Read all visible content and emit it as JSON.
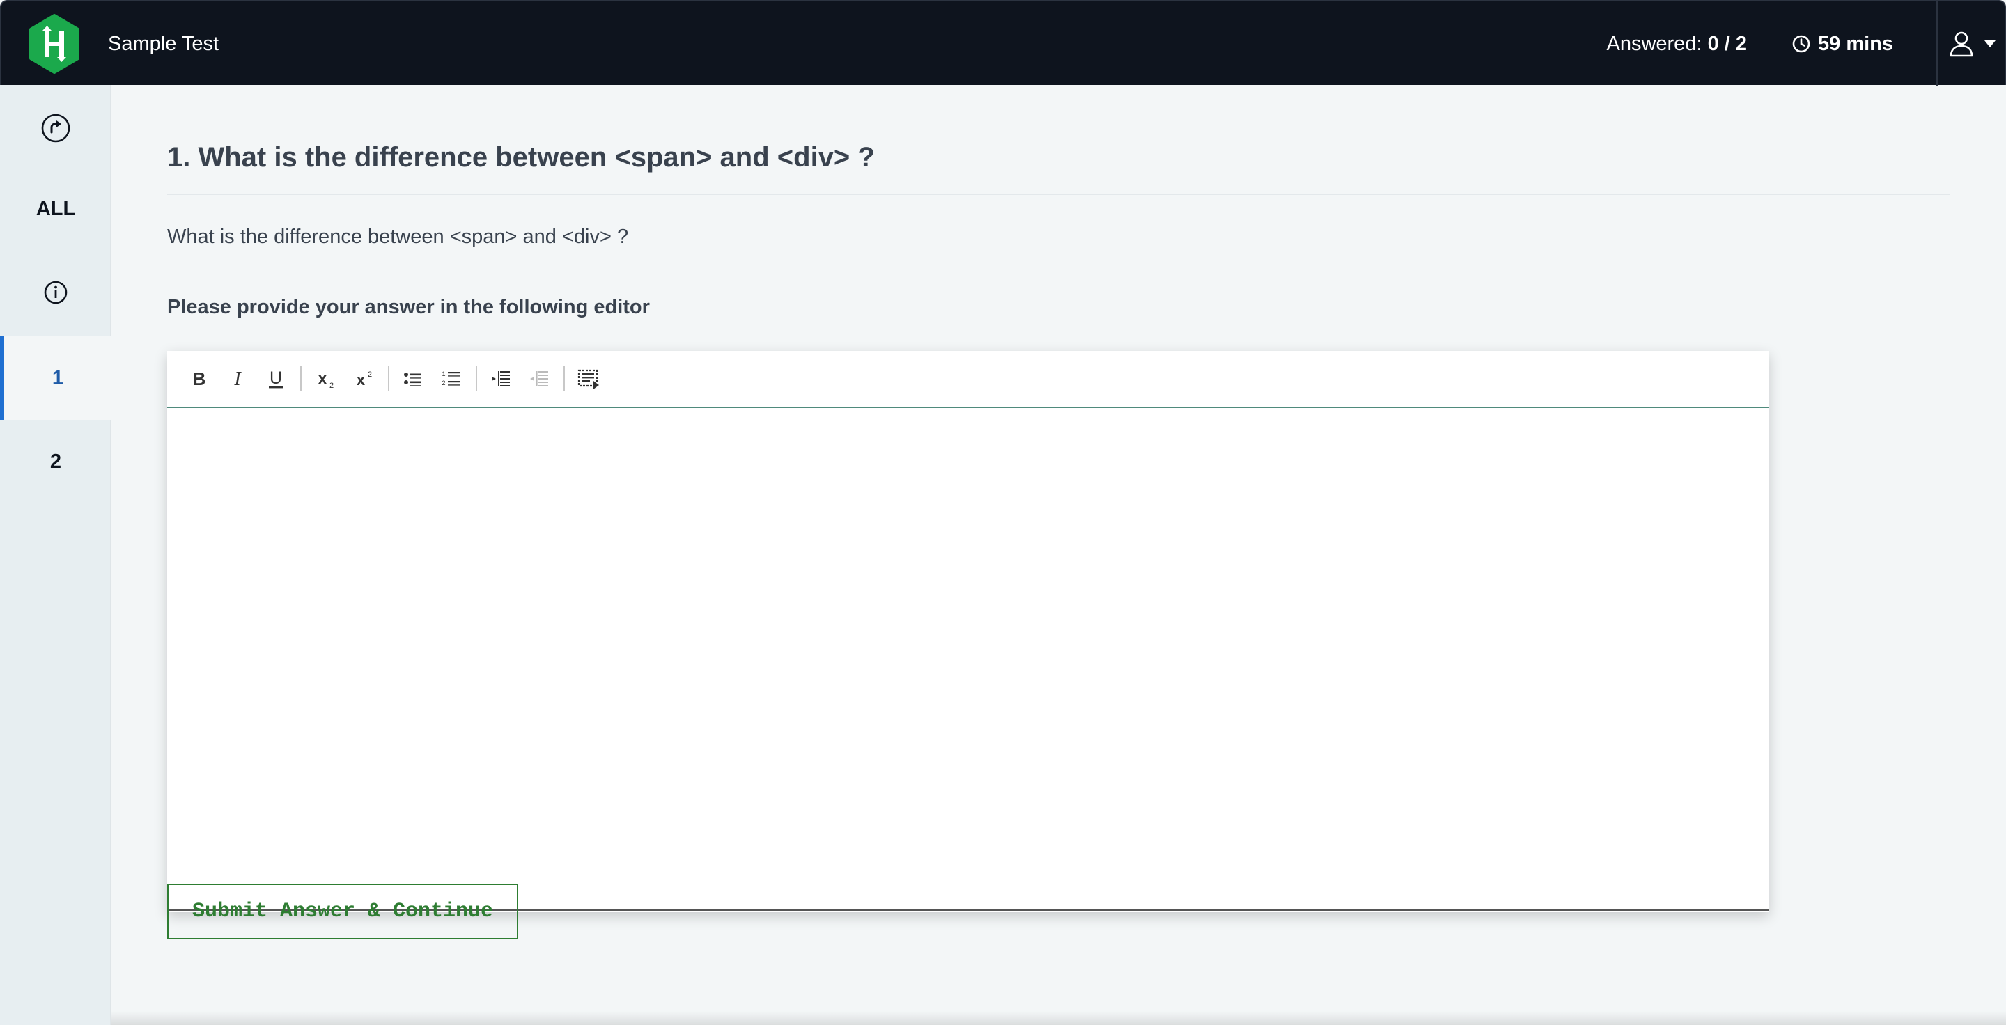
{
  "header": {
    "app_name": "Sample Test",
    "answered_label": "Answered:",
    "answered_value": "0 / 2",
    "timer_value": "59 mins",
    "logo_icon": "hackerrank-logo",
    "timer_icon": "clock-icon",
    "user_icon": "user-icon",
    "colors": {
      "background": "#0e141e",
      "logo": "#1ba94c"
    }
  },
  "sidebar": {
    "items": [
      {
        "type": "icon",
        "icon": "compass-icon"
      },
      {
        "type": "text",
        "label": "ALL"
      },
      {
        "type": "icon",
        "icon": "info-icon"
      },
      {
        "type": "text",
        "label": "1",
        "active": true
      },
      {
        "type": "text",
        "label": "2"
      }
    ],
    "colors": {
      "active": "#1f6fd1",
      "background": "#e7eef1"
    }
  },
  "question": {
    "title": "1. What is the difference between <span> and <div> ?",
    "text": "What is the difference between <span> and <div> ?",
    "instruction": "Please provide your answer in the following editor"
  },
  "editor": {
    "content": "",
    "toolbar": [
      {
        "name": "bold-button",
        "icon": "bold-icon"
      },
      {
        "name": "italic-button",
        "icon": "italic-icon"
      },
      {
        "name": "underline-button",
        "icon": "underline-icon"
      },
      {
        "name": "subscript-button",
        "icon": "subscript-icon"
      },
      {
        "name": "superscript-button",
        "icon": "superscript-icon"
      },
      {
        "name": "bulleted-list-button",
        "icon": "bulleted-list-icon"
      },
      {
        "name": "numbered-list-button",
        "icon": "numbered-list-icon"
      },
      {
        "name": "indent-button",
        "icon": "indent-icon"
      },
      {
        "name": "outdent-button",
        "icon": "outdent-icon",
        "disabled": true
      },
      {
        "name": "source-button",
        "icon": "source-code-icon"
      }
    ]
  },
  "actions": {
    "submit_label": "Submit Answer & Continue",
    "colors": {
      "submit": "#2e7d32"
    }
  }
}
